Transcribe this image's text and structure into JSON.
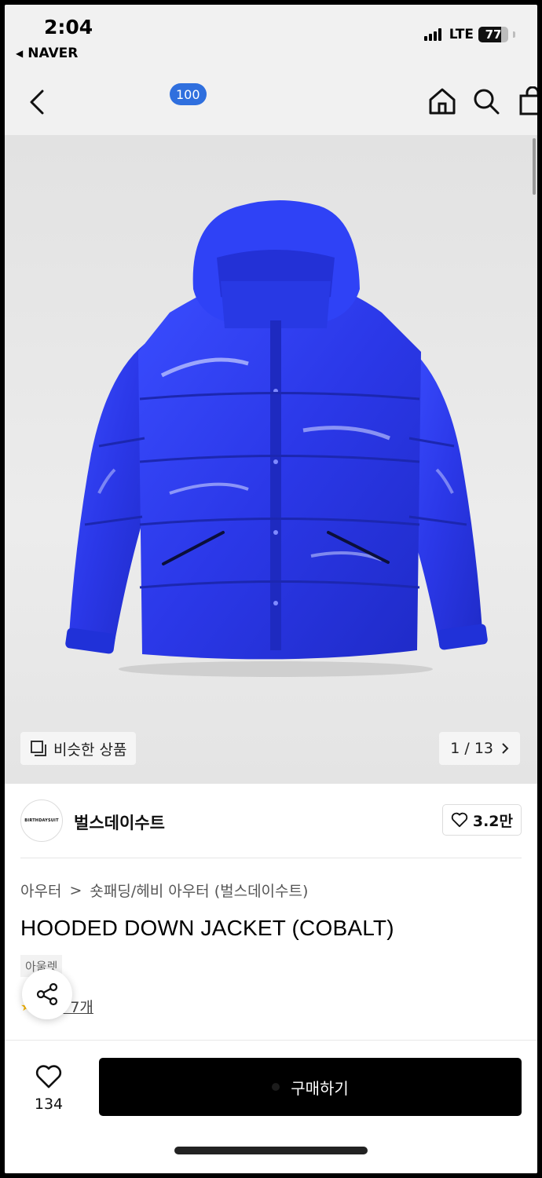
{
  "status_bar": {
    "time": "2:04",
    "back_app": "NAVER",
    "network": "LTE",
    "battery": "77",
    "battery_level": 0.77
  },
  "header": {
    "cart_count": "100"
  },
  "gallery": {
    "similar_label": "비슷한 상품",
    "pager": "1 / 13"
  },
  "brand": {
    "logo_text": "BIRTHDAYSUIT",
    "name": "벌스데이수트",
    "likes": "3.2만"
  },
  "product": {
    "breadcrumb": [
      "아우터",
      "숏패딩/헤비 아우터 (벌스데이수트)"
    ],
    "title": "HOODED DOWN JACKET (COBALT)",
    "tag": "아울렛",
    "review_link": "후기 7개"
  },
  "bottom_bar": {
    "wish_count": "134",
    "buy_label": "구매하기"
  },
  "colors": {
    "jacket": "#2d3df2",
    "badge": "#2f6fde",
    "buy_button": "#000000"
  }
}
